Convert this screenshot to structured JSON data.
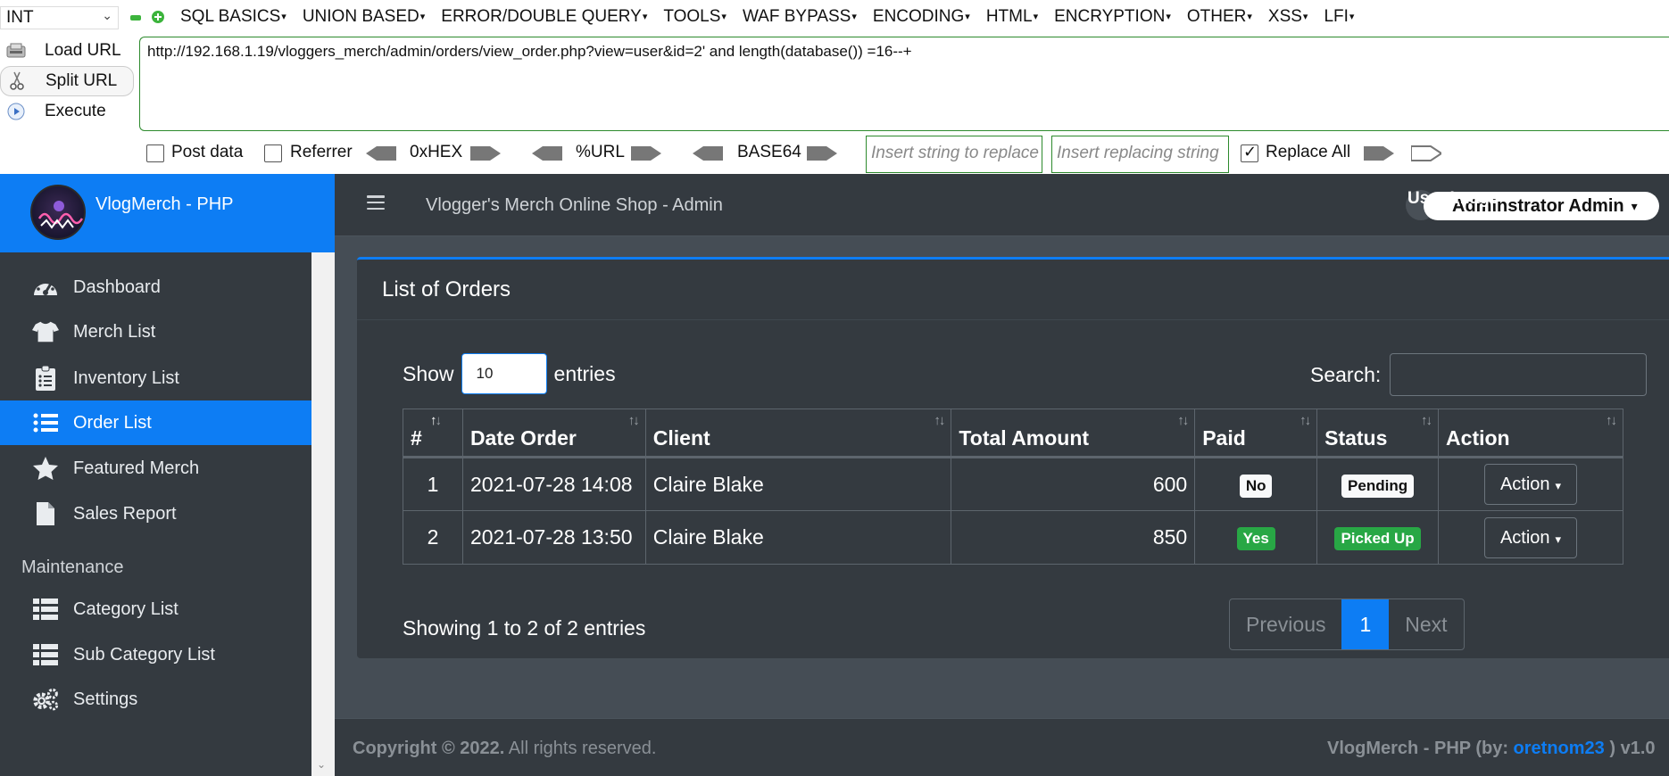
{
  "hackbar": {
    "injection_type": "INT",
    "menus": [
      "SQL BASICS",
      "UNION BASED",
      "ERROR/DOUBLE QUERY",
      "TOOLS",
      "WAF BYPASS",
      "ENCODING",
      "HTML",
      "ENCRYPTION",
      "OTHER",
      "XSS",
      "LFI"
    ],
    "load_url": "Load URL",
    "split_url": "Split URL",
    "execute": "Execute",
    "url": "http://192.168.1.19/vloggers_merch/admin/orders/view_order.php?view=user&id=2' and length(database()) =16--+",
    "post_data": "Post data",
    "referrer": "Referrer",
    "hex": "0xHEX",
    "urlenc": "%URL",
    "base64": "BASE64",
    "replace_placeholder": "Insert string to replace",
    "replacing_placeholder": "Insert replacing string",
    "replace_all": "Replace All",
    "colors": {
      "border_green": "#2d8a2d"
    }
  },
  "brand": {
    "name": "VlogMerch - PHP"
  },
  "sidebar": {
    "items": [
      {
        "label": "Dashboard",
        "icon": "tachometer-icon"
      },
      {
        "label": "Merch List",
        "icon": "tshirt-icon"
      },
      {
        "label": "Inventory List",
        "icon": "clipboard-list-icon"
      },
      {
        "label": "Order List",
        "icon": "list-icon"
      },
      {
        "label": "Featured Merch",
        "icon": "star-icon"
      },
      {
        "label": "Sales Report",
        "icon": "file-icon"
      }
    ],
    "maintenance_header": "Maintenance",
    "maintenance_items": [
      {
        "label": "Category List",
        "icon": "th-list-icon"
      },
      {
        "label": "Sub Category List",
        "icon": "th-list-icon"
      },
      {
        "label": "Settings",
        "icon": "cogs-icon"
      }
    ],
    "active": "Order List"
  },
  "topnav": {
    "title": "Vlogger's Merch Online Shop - Admin",
    "user_image_alt": "User Image",
    "user_name": "Adminstrator Admin"
  },
  "card": {
    "title": "List of Orders",
    "show_label": "Show",
    "entries_value": "10",
    "entries_label": "entries",
    "search_label": "Search:",
    "columns": [
      "#",
      "Date Order",
      "Client",
      "Total Amount",
      "Paid",
      "Status",
      "Action"
    ],
    "rows": [
      {
        "num": "1",
        "date": "2021-07-28 14:08",
        "client": "Claire Blake",
        "total": "600",
        "paid": "No",
        "status": "Pending",
        "action": "Action"
      },
      {
        "num": "2",
        "date": "2021-07-28 13:50",
        "client": "Claire Blake",
        "total": "850",
        "paid": "Yes",
        "status": "Picked Up",
        "action": "Action"
      }
    ],
    "info": "Showing 1 to 2 of 2 entries",
    "pager": {
      "prev": "Previous",
      "current": "1",
      "next": "Next"
    }
  },
  "footer": {
    "copyright_bold": "Copyright © 2022.",
    "copyright_rest": " All rights reserved.",
    "right_text": "VlogMerch - PHP (by: ",
    "author": "oretnom23",
    "right_tail": " ) v1.0"
  },
  "colors": {
    "accent": "#0d7df4",
    "sidebar_bg": "#343a40",
    "content_bg": "#454d55",
    "success": "#28a745"
  }
}
